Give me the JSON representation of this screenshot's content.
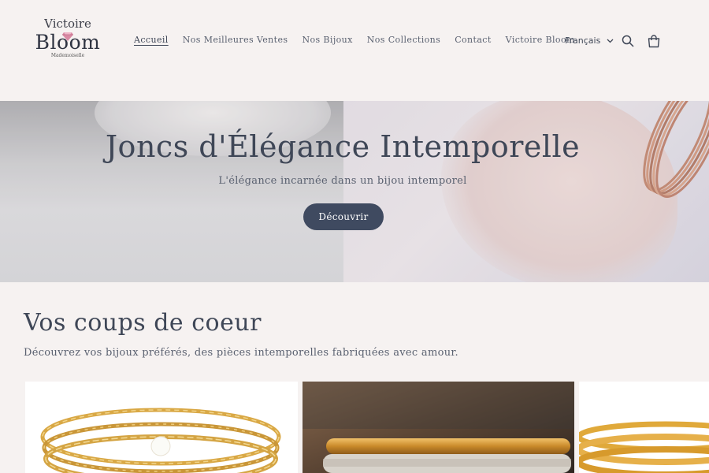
{
  "brand": {
    "line1": "Victoire",
    "line2": "Bloom",
    "line3": "Mademoiselle"
  },
  "nav": {
    "items": [
      {
        "label": "Accueil",
        "active": true
      },
      {
        "label": "Nos Meilleures Ventes"
      },
      {
        "label": "Nos Bijoux"
      },
      {
        "label": "Nos Collections"
      },
      {
        "label": "Contact"
      },
      {
        "label": "Victoire Bloom"
      }
    ]
  },
  "header_actions": {
    "language": "Français",
    "icons": [
      "chevron-down-icon",
      "search-icon",
      "cart-icon"
    ]
  },
  "hero": {
    "title": "Joncs d'Élégance Intemporelle",
    "subtitle": "L'élégance incarnée dans un bijou intemporel",
    "cta_label": "Découvrir"
  },
  "featured": {
    "title": "Vos coups de coeur",
    "subtitle": "Découvrez vos bijoux préférés, des pièces intemporelles fabriquées avec amour."
  },
  "colors": {
    "background": "#f6f2f1",
    "text": "#3f4757",
    "button": "#3f4a60",
    "gem": "#d98aa4",
    "gold": "#d7a33b"
  }
}
